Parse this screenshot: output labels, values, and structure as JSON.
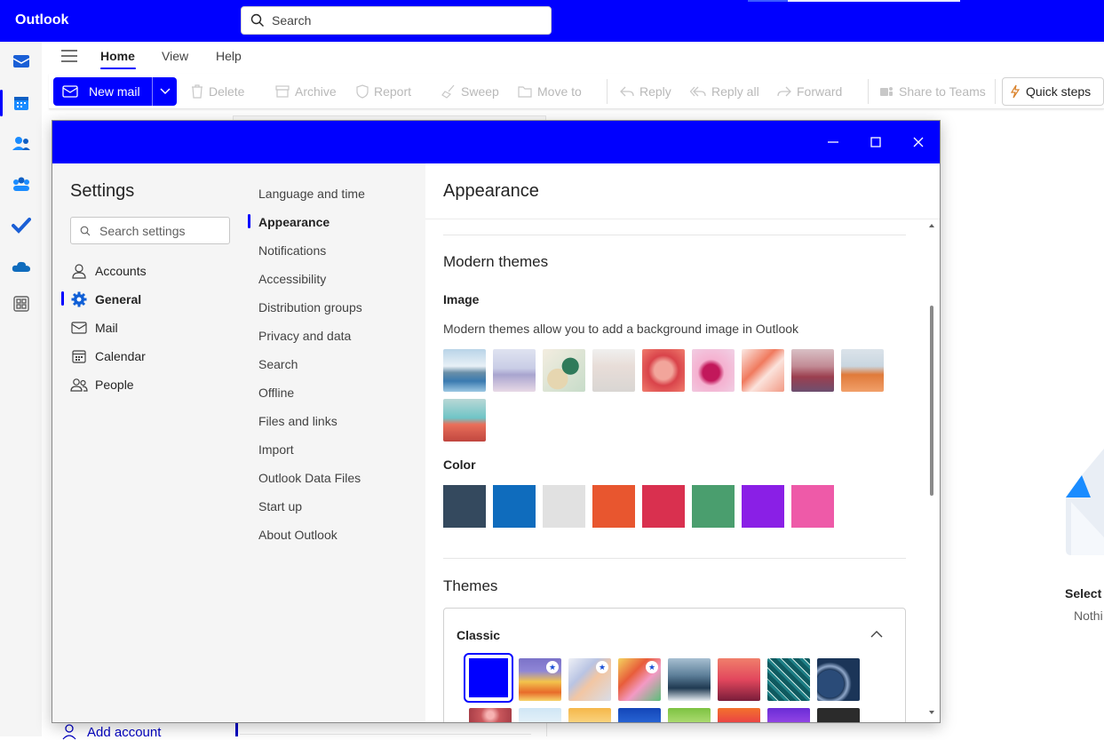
{
  "app": {
    "title": "Outlook"
  },
  "search": {
    "placeholder": "Search"
  },
  "ribbon_tabs": [
    "Home",
    "View",
    "Help"
  ],
  "ribbon": {
    "new_mail": "New mail",
    "delete": "Delete",
    "archive": "Archive",
    "report": "Report",
    "sweep": "Sweep",
    "move_to": "Move to",
    "reply": "Reply",
    "reply_all": "Reply all",
    "forward": "Forward",
    "share_teams": "Share to Teams",
    "quick_steps": "Quick steps"
  },
  "rail_icons": [
    "mail-icon",
    "calendar-icon",
    "people-icon",
    "groups-icon",
    "todo-icon",
    "onedrive-icon",
    "apps-icon"
  ],
  "background": {
    "add_account": "Add account",
    "empty_title": "Select a",
    "empty_sub": "Nothi"
  },
  "settings": {
    "title": "Settings",
    "search_placeholder": "Search settings",
    "categories": [
      {
        "label": "Accounts",
        "icon": "person-icon"
      },
      {
        "label": "General",
        "icon": "gear-icon",
        "active": true
      },
      {
        "label": "Mail",
        "icon": "mail-icon"
      },
      {
        "label": "Calendar",
        "icon": "calendar-icon"
      },
      {
        "label": "People",
        "icon": "people-icon"
      }
    ],
    "subnav": [
      "Language and time",
      "Appearance",
      "Notifications",
      "Accessibility",
      "Distribution groups",
      "Privacy and data",
      "Search",
      "Offline",
      "Files and links",
      "Import",
      "Outlook Data Files",
      "Start up",
      "About Outlook"
    ],
    "active_subnav": "Appearance"
  },
  "appearance": {
    "heading": "Appearance",
    "modern_themes": "Modern themes",
    "image_label": "Image",
    "image_desc": "Modern themes allow you to add a background image in Outlook",
    "color_label": "Color",
    "colors": [
      "#34495e",
      "#0f6cbd",
      "#e1e1e1",
      "#e8562f",
      "#d9304f",
      "#4a9e6e",
      "#8a1fe6",
      "#ee5aa8"
    ],
    "themes_heading": "Themes",
    "classic_label": "Classic"
  }
}
